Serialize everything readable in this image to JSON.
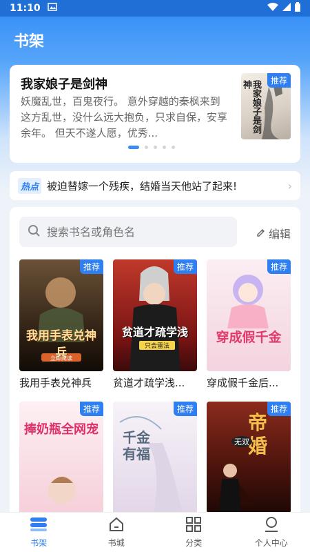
{
  "status": {
    "time": "11:10"
  },
  "header": {
    "title": "书架"
  },
  "featured": {
    "title": "我家娘子是剑神",
    "description": "妖魔乱世，百鬼夜行。 意外穿越的秦枫来到这方乱世，没什么远大抱负，只求自保，安享余年。 但天不遂人愿，优秀...",
    "tag": "推荐",
    "cover_text": "我家娘子是剑神",
    "page_count": 5,
    "active_page": 1
  },
  "hot": {
    "badge": "热点",
    "text": "被迫替嫁一个残疾，结婚当天他站了起来!"
  },
  "search": {
    "placeholder": "搜索书名或角色名",
    "edit_label": "编辑"
  },
  "books": [
    {
      "name": "我用手表兑神兵",
      "tag": "推荐",
      "cover_text": "我用手表兑神兵",
      "cover_sub": "立即阅读",
      "color_a": "#4a3a2a",
      "color_b": "#1a1410"
    },
    {
      "name": "贫道才疏学浅...",
      "tag": "推荐",
      "cover_text": "贫道才疏学浅",
      "cover_sub": "只会雷法",
      "color_a": "#c0392b",
      "color_b": "#5a0e0e"
    },
    {
      "name": "穿成假千金后...",
      "tag": "推荐",
      "cover_text": "穿成假千金",
      "cover_sub": "",
      "color_a": "#f8dde6",
      "color_b": "#e9b6c8"
    },
    {
      "name": "",
      "tag": "推荐",
      "cover_text": "捧奶瓶全网宠",
      "cover_sub": "",
      "color_a": "#fbe7ec",
      "color_b": "#f3c9d4"
    },
    {
      "name": "",
      "tag": "推荐",
      "cover_text": "千金有福",
      "cover_sub": "",
      "color_a": "#f5f0f6",
      "color_b": "#d9cde2"
    },
    {
      "name": "",
      "tag": "推荐",
      "cover_text": "帝婚",
      "cover_sub": "无双",
      "color_a": "#8a2b1c",
      "color_b": "#2b0c08"
    }
  ],
  "tabs": [
    {
      "label": "书架",
      "icon": "bookshelf-icon",
      "active": true
    },
    {
      "label": "书城",
      "icon": "home-icon",
      "active": false
    },
    {
      "label": "分类",
      "icon": "grid-icon",
      "active": false
    },
    {
      "label": "个人中心",
      "icon": "user-icon",
      "active": false
    }
  ]
}
